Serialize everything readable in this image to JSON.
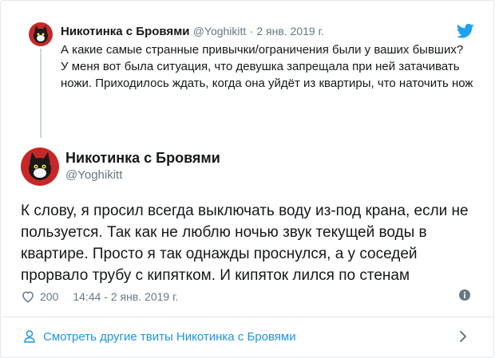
{
  "parent_tweet": {
    "name": "Никотинка с Бровями",
    "handle": "@Yoghikitt",
    "separator": "·",
    "date": "2 янв. 2019 г.",
    "text_line1": "А какие самые странные привычки/ограничения были у ваших бывших?",
    "text_line2": "У меня вот была ситуация, что девушка запрещала при ней затачивать ножи. Приходилось ждать, когда она уйдёт из квартиры, что наточить нож"
  },
  "main_tweet": {
    "name": "Никотинка с Бровями",
    "handle": "@Yoghikitt",
    "text": "К слову, я просил всегда выключать воду из-под крана, если не пользуется. Так как не люблю ночью звук текущей воды в квартире. Просто я так однажды проснулся, а у соседей прорвало трубу с кипятком. И кипяток лился по стенам",
    "likes": "200",
    "timestamp": "14:44 - 2 янв. 2019 г."
  },
  "footer": {
    "more_label": "Смотреть другие твиты Никотинка с Бровями"
  },
  "icons": {
    "brand": "twitter-bird-icon",
    "like": "heart-icon",
    "info": "info-icon",
    "person": "person-icon",
    "chevron": "chevron-right-icon"
  },
  "colors": {
    "brand_blue": "#1da1f2",
    "link_blue": "#1b95e0",
    "muted": "#657786",
    "text": "#14171a",
    "border": "#e1e8ed"
  }
}
